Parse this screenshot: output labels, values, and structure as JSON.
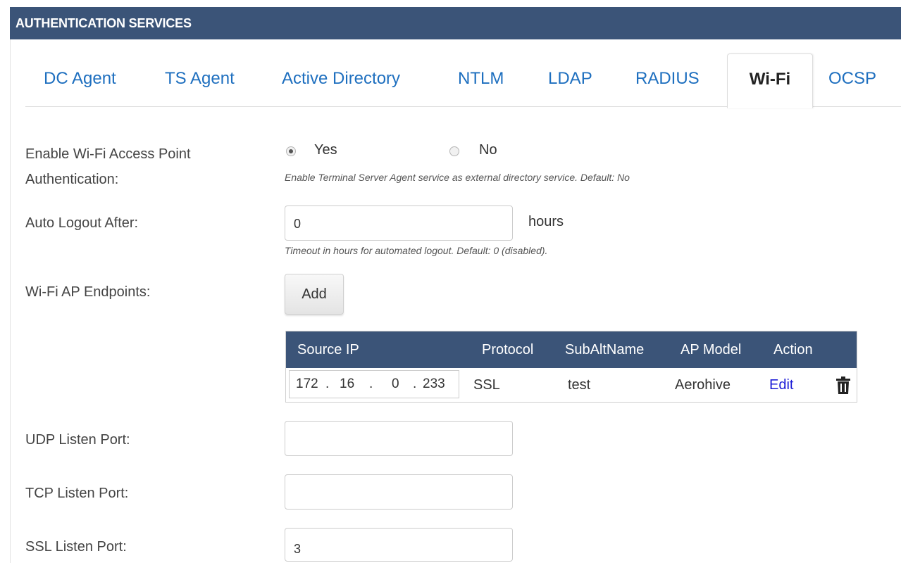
{
  "header": {
    "title": "AUTHENTICATION SERVICES"
  },
  "tabs": [
    {
      "label": "DC Agent",
      "active": false
    },
    {
      "label": "TS Agent",
      "active": false
    },
    {
      "label": "Active Directory",
      "active": false
    },
    {
      "label": "NTLM",
      "active": false
    },
    {
      "label": "LDAP",
      "active": false
    },
    {
      "label": "RADIUS",
      "active": false
    },
    {
      "label": "Wi-Fi",
      "active": true
    },
    {
      "label": "OCSP",
      "active": false
    }
  ],
  "form": {
    "enable_wifi": {
      "label_line1": "Enable Wi-Fi Access Point",
      "label_line2": "Authentication:",
      "options": [
        {
          "label": "Yes",
          "checked": true
        },
        {
          "label": "No",
          "checked": false
        }
      ],
      "hint": "Enable Terminal Server Agent service as external directory service. Default: No"
    },
    "auto_logout": {
      "label": "Auto Logout After:",
      "value": "0",
      "unit": "hours",
      "hint": "Timeout in hours for automated logout. Default: 0 (disabled)."
    },
    "endpoints": {
      "label": "Wi-Fi AP Endpoints:",
      "add_button": "Add",
      "columns": [
        "Source IP",
        "Protocol",
        "SubAltName",
        "AP Model",
        "Action"
      ],
      "rows": [
        {
          "ip_parts": [
            "172",
            "16",
            "0",
            "233"
          ],
          "protocol": "SSL",
          "subaltname": "test",
          "ap_model": "Aerohive",
          "action_edit": "Edit",
          "action_delete_icon": "trash-icon"
        }
      ]
    },
    "udp_port": {
      "label": "UDP Listen Port:",
      "value": ""
    },
    "tcp_port": {
      "label": "TCP Listen Port:",
      "value": ""
    },
    "ssl_port": {
      "label": "SSL Listen Port:",
      "value": "3"
    }
  },
  "colors": {
    "header_bg": "#3b5478",
    "tab_link": "#1e6fbf",
    "edit_link": "#1b1bd6"
  }
}
